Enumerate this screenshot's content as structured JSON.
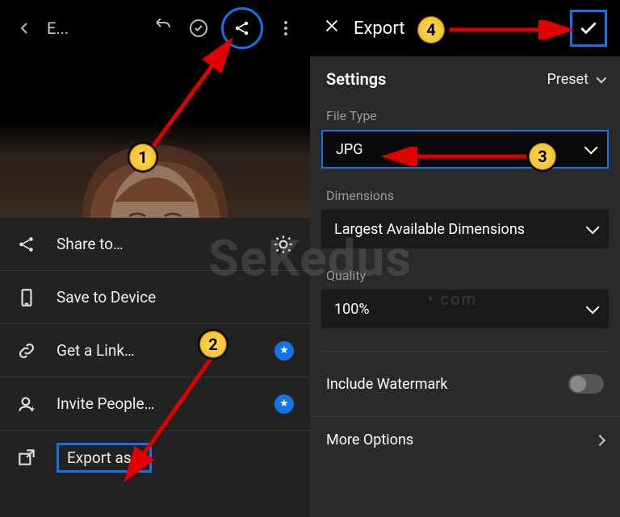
{
  "left": {
    "edit_label": "E...",
    "photo_alt": "photo-preview",
    "sheet": {
      "share_to": "Share to…",
      "save_device": "Save to Device",
      "get_link": "Get a Link…",
      "invite_people": "Invite People…",
      "export_as": "Export as…"
    }
  },
  "right": {
    "title": "Export",
    "settings_header": "Settings",
    "preset_label": "Preset",
    "file_type_label": "File Type",
    "file_type_value": "JPG",
    "dimensions_label": "Dimensions",
    "dimensions_value": "Largest Available Dimensions",
    "quality_label": "Quality",
    "quality_value": "100%",
    "include_watermark": "Include Watermark",
    "more_options": "More Options"
  },
  "badges": {
    "b1": "1",
    "b2": "2",
    "b3": "3",
    "b4": "4"
  },
  "watermark": {
    "main": "SeKedus",
    "sub": "• com"
  }
}
